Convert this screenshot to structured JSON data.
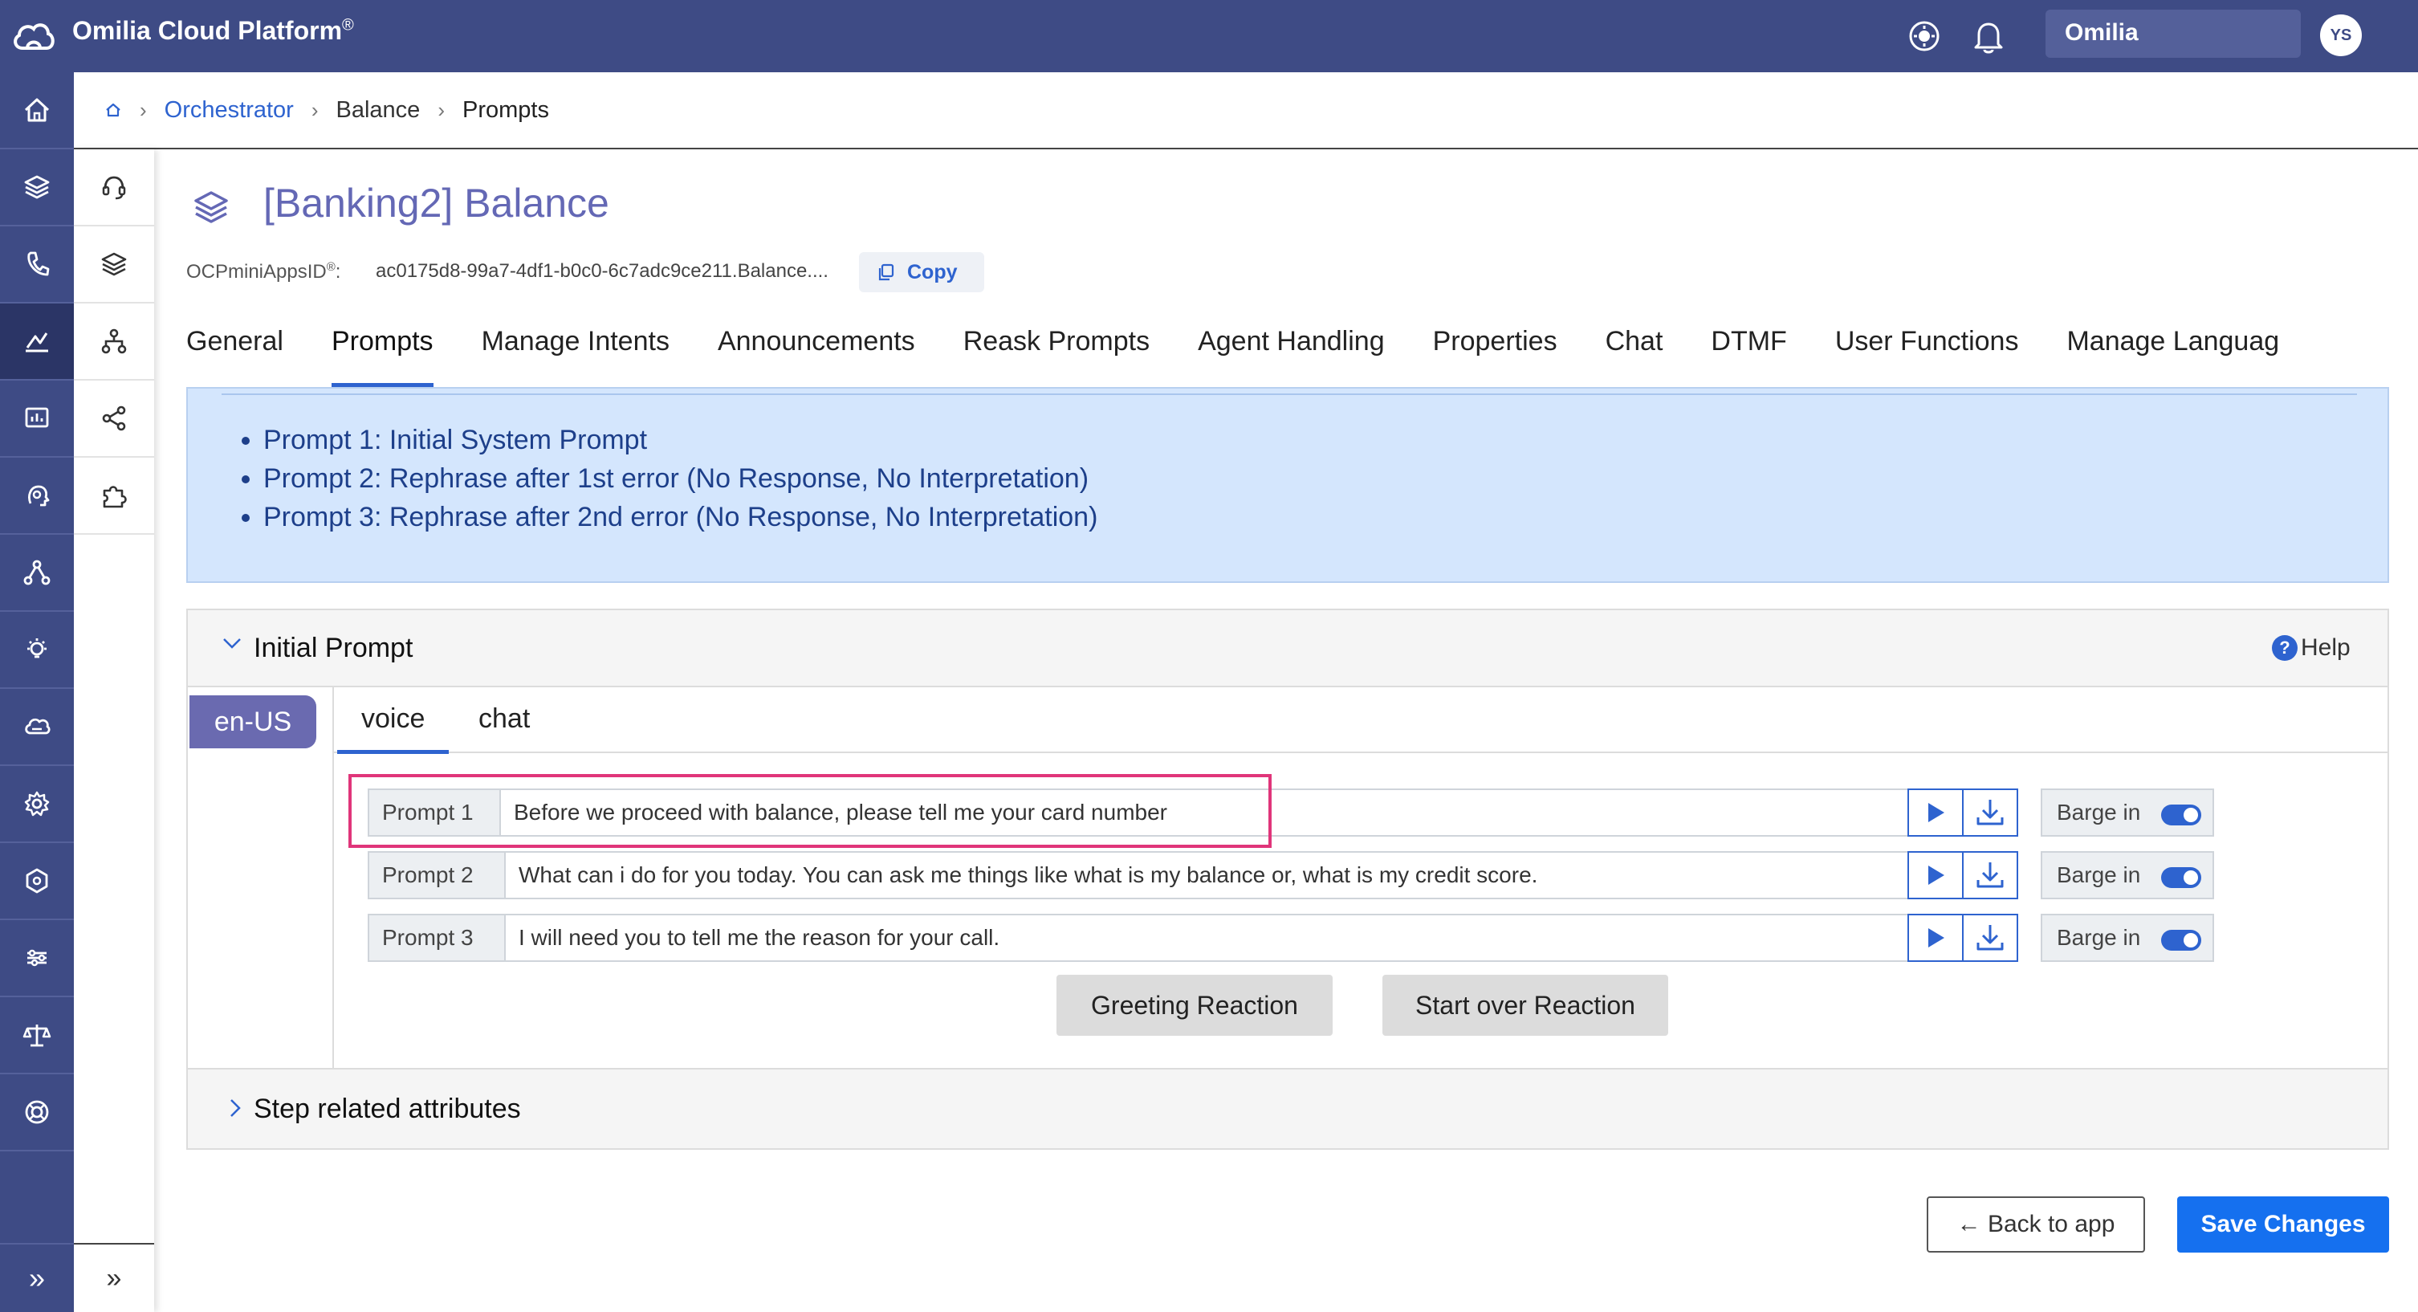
{
  "app": {
    "title": "Omilia Cloud Platform",
    "title_mark": "®",
    "org": "Omilia",
    "user_initials": "YS"
  },
  "breadcrumb": {
    "items": [
      "Orchestrator",
      "Balance",
      "Prompts"
    ]
  },
  "page": {
    "title": "[Banking2] Balance",
    "appid_label": "OCPminiAppsID",
    "appid_mark": "®",
    "appid_suffix": ":",
    "appid_value": "ac0175d8-99a7-4df1-b0c0-6c7adc9ce211.Balance....",
    "copy_label": "Copy"
  },
  "tabs": [
    {
      "label": "General"
    },
    {
      "label": "Prompts",
      "active": true
    },
    {
      "label": "Manage Intents"
    },
    {
      "label": "Announcements"
    },
    {
      "label": "Reask Prompts"
    },
    {
      "label": "Agent Handling"
    },
    {
      "label": "Properties"
    },
    {
      "label": "Chat"
    },
    {
      "label": "DTMF"
    },
    {
      "label": "User Functions"
    },
    {
      "label": "Manage Languag"
    }
  ],
  "info": {
    "items": [
      "Prompt 1: Initial System Prompt",
      "Prompt 2: Rephrase after 1st error (No Response, No Interpretation)",
      "Prompt 3: Rephrase after 2nd error (No Response, No Interpretation)"
    ]
  },
  "initial_prompt": {
    "title": "Initial Prompt",
    "help_label": "Help",
    "language": "en-US",
    "channel_tabs": [
      "voice",
      "chat"
    ],
    "active_channel": "voice",
    "prompts": [
      {
        "label": "Prompt 1",
        "text": "Before we proceed with balance, please tell me your card number",
        "barge_label": "Barge in",
        "barge_on": true
      },
      {
        "label": "Prompt 2",
        "text": "What can i do for you today. You can ask me things like what is my balance or, what is my credit score.",
        "barge_label": "Barge in",
        "barge_on": true
      },
      {
        "label": "Prompt 3",
        "text": "I will need you to tell me the reason for your call.",
        "barge_label": "Barge in",
        "barge_on": true
      }
    ],
    "greeting_button": "Greeting Reaction",
    "start_over_button": "Start over Reaction"
  },
  "step_attributes": {
    "title": "Step related attributes"
  },
  "footer": {
    "back_label": "← Back to app",
    "save_label": "Save Changes"
  },
  "colors": {
    "topbar": "#3e4b85",
    "accent": "#2e63cf",
    "title": "#6468b5",
    "highlight": "#e0357a",
    "info_bg": "#d4e6fd"
  }
}
